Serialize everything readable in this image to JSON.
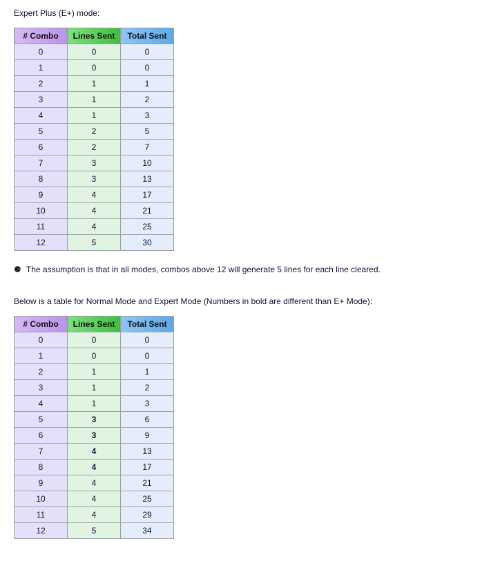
{
  "text": {
    "title1": "Expert Plus (E+) mode:",
    "noteLead": "⚈",
    "noteText": "The assumption is that in all modes, combos above 12 will generate 5 lines for each line cleared.",
    "title2": "Below is a table for Normal Mode and Expert Mode (Numbers in bold are different than E+ Mode):"
  },
  "headers": {
    "combo": "# Combo",
    "lines": "Lines Sent",
    "total": "Total Sent"
  },
  "chart_data": [
    {
      "type": "table",
      "title": "Expert Plus (E+) mode",
      "columns": [
        "# Combo",
        "Lines Sent",
        "Total Sent"
      ],
      "rows": [
        {
          "combo": 0,
          "lines": 0,
          "total": 0
        },
        {
          "combo": 1,
          "lines": 0,
          "total": 0
        },
        {
          "combo": 2,
          "lines": 1,
          "total": 1
        },
        {
          "combo": 3,
          "lines": 1,
          "total": 2
        },
        {
          "combo": 4,
          "lines": 1,
          "total": 3
        },
        {
          "combo": 5,
          "lines": 2,
          "total": 5
        },
        {
          "combo": 6,
          "lines": 2,
          "total": 7
        },
        {
          "combo": 7,
          "lines": 3,
          "total": 10
        },
        {
          "combo": 8,
          "lines": 3,
          "total": 13
        },
        {
          "combo": 9,
          "lines": 4,
          "total": 17
        },
        {
          "combo": 10,
          "lines": 4,
          "total": 21
        },
        {
          "combo": 11,
          "lines": 4,
          "total": 25
        },
        {
          "combo": 12,
          "lines": 5,
          "total": 30
        }
      ]
    },
    {
      "type": "table",
      "title": "Normal Mode and Expert Mode (bold = different from E+)",
      "columns": [
        "# Combo",
        "Lines Sent",
        "Total Sent"
      ],
      "rows": [
        {
          "combo": 0,
          "lines": 0,
          "total": 0
        },
        {
          "combo": 1,
          "lines": 0,
          "total": 0
        },
        {
          "combo": 2,
          "lines": 1,
          "total": 1
        },
        {
          "combo": 3,
          "lines": 1,
          "total": 2
        },
        {
          "combo": 4,
          "lines": 1,
          "total": 3
        },
        {
          "combo": 5,
          "lines": 3,
          "lines_bold": true,
          "total": 6
        },
        {
          "combo": 6,
          "lines": 3,
          "lines_bold": true,
          "total": 9
        },
        {
          "combo": 7,
          "lines": 4,
          "lines_bold": true,
          "total": 13
        },
        {
          "combo": 8,
          "lines": 4,
          "lines_bold": true,
          "total": 17
        },
        {
          "combo": 9,
          "lines": 4,
          "total": 21
        },
        {
          "combo": 10,
          "lines": 4,
          "total": 25
        },
        {
          "combo": 11,
          "lines": 4,
          "total": 29
        },
        {
          "combo": 12,
          "lines": 5,
          "total": 34
        }
      ]
    }
  ]
}
